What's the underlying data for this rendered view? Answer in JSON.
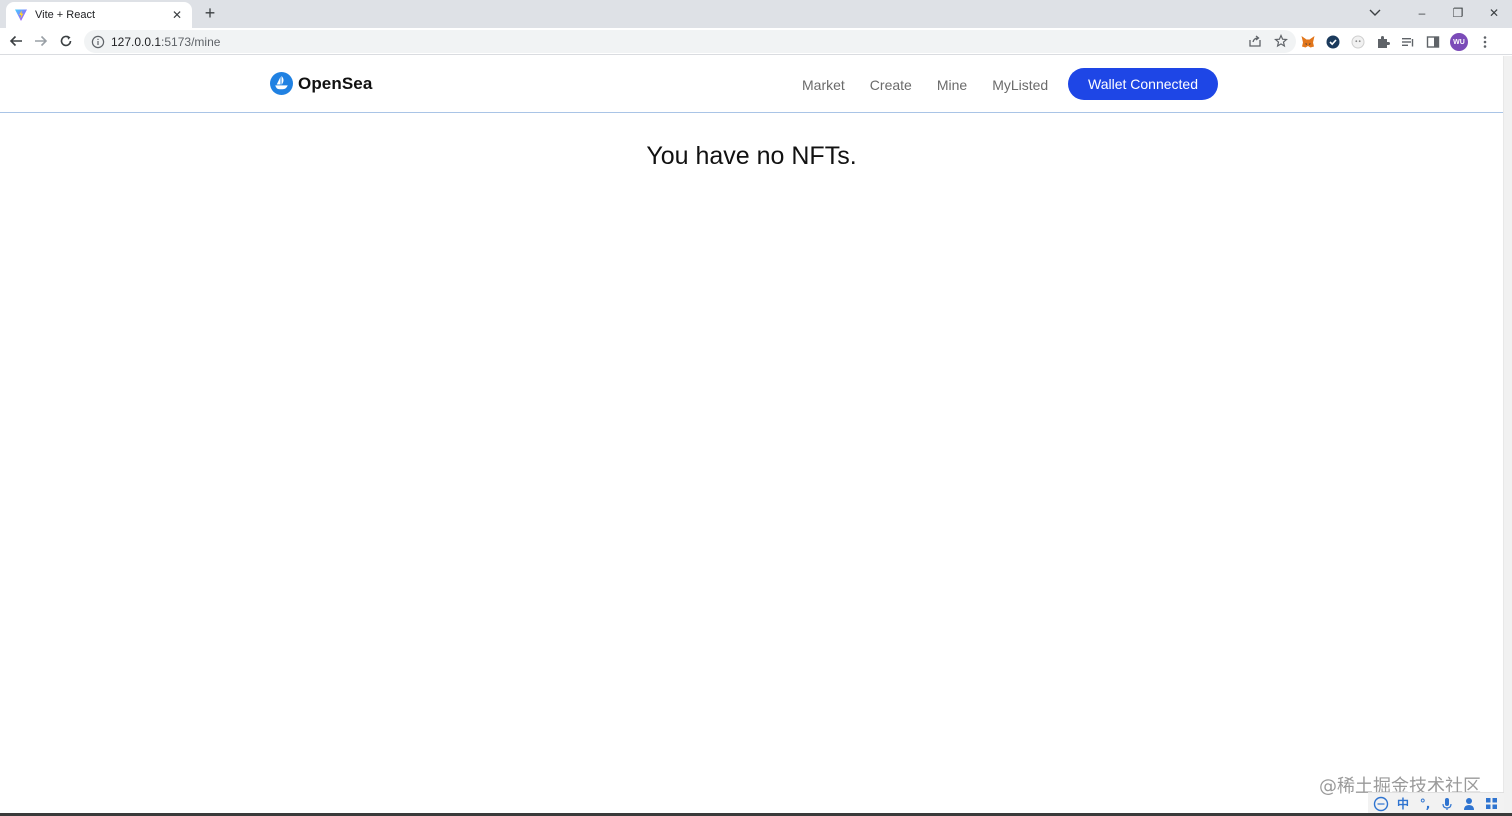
{
  "browser": {
    "tab_title": "Vite + React",
    "tab_close_glyph": "✕",
    "new_tab_glyph": "+",
    "url_host": "127.0.0.1",
    "url_path": ":5173/mine",
    "profile_initials": "WU",
    "window_controls": [
      "–",
      "❐",
      "✕"
    ]
  },
  "site": {
    "logo_text": "OpenSea",
    "nav": [
      "Market",
      "Create",
      "Mine",
      "MyListed"
    ],
    "wallet_button": "Wallet Connected"
  },
  "main": {
    "empty_message": "You have no NFTs."
  },
  "watermark": "@稀土掘金技术社区",
  "ime": {
    "lang": "中",
    "punct": "°,"
  },
  "colors": {
    "accent": "#1e46e6",
    "logo_blue": "#2081e2",
    "header_border": "#a9c4e6"
  }
}
